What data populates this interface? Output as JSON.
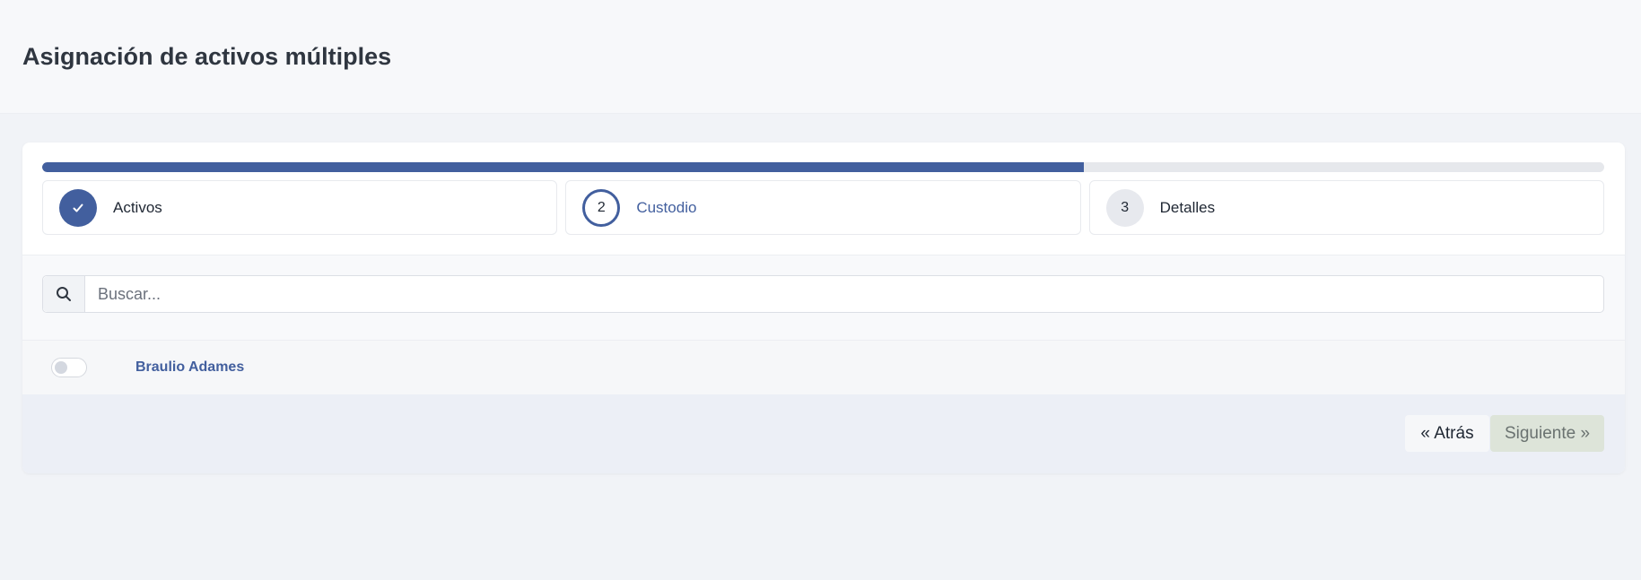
{
  "page": {
    "title": "Asignación de activos múltiples"
  },
  "progress": {
    "percent": 66.67,
    "color": "#425f9e"
  },
  "steps": [
    {
      "number": "",
      "label": "Activos",
      "state": "done",
      "icon": "check-icon"
    },
    {
      "number": "2",
      "label": "Custodio",
      "state": "active"
    },
    {
      "number": "3",
      "label": "Detalles",
      "state": "pending"
    }
  ],
  "search": {
    "placeholder": "Buscar...",
    "value": "",
    "icon": "search-icon"
  },
  "custodians": [
    {
      "name": "Braulio Adames",
      "selected": false
    }
  ],
  "footer": {
    "back_label": "« Atrás",
    "next_label": "Siguiente »"
  },
  "colors": {
    "accent": "#425f9e",
    "next_button_bg": "#dde4d9"
  }
}
